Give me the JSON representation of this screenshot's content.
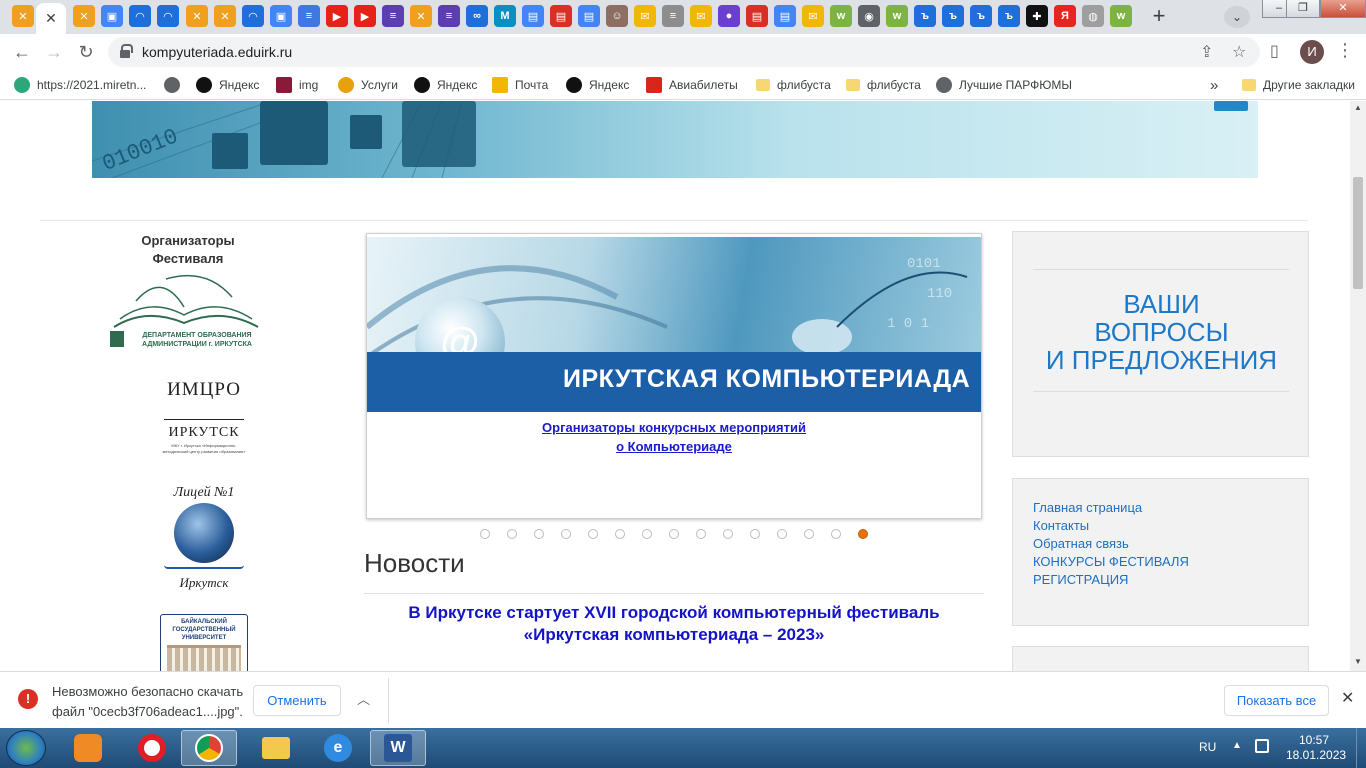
{
  "browser": {
    "url": "kompyuteriada.eduirk.ru",
    "new_tab_label": "+",
    "avatar_letter": "И",
    "bookmarks": [
      {
        "label": "https://2021.miretn...",
        "icon": "puzzle-icon",
        "color": "#2aa87a"
      },
      {
        "label": "",
        "icon": "globe-icon",
        "color": "#5f6368"
      },
      {
        "label": "Яндекс",
        "icon": "plus-circle-icon",
        "color": "#111111"
      },
      {
        "label": "img",
        "icon": "soundwave-icon",
        "color": "#8b1a3a"
      },
      {
        "label": "Услуги",
        "icon": "gosuslugi-icon",
        "color": "#e8a10a"
      },
      {
        "label": "Яндекс",
        "icon": "plus-circle-icon",
        "color": "#111111"
      },
      {
        "label": "Почта",
        "icon": "mail-icon",
        "color": "#f2b705"
      },
      {
        "label": "Яндекс",
        "icon": "plus-circle-icon",
        "color": "#111111"
      },
      {
        "label": "Авиабилеты",
        "icon": "ticket-icon",
        "color": "#d9261c"
      },
      {
        "label": "флибуста",
        "icon": "folder-icon",
        "color": "#f7d774"
      },
      {
        "label": "флибуста",
        "icon": "folder-icon",
        "color": "#f7d774"
      },
      {
        "label": "Лучшие ПАРФЮМЫ",
        "icon": "globe-icon",
        "color": "#5f6368"
      }
    ],
    "more_bookmarks": "»",
    "other_bookmarks": "Другие закладки"
  },
  "page": {
    "organizers_title": "Организаторы Фестиваля",
    "logos": {
      "dept": "ДЕПАРТАМЕНТ ОБРАЗОВАНИЯ АДМИНИСТРАЦИИ г. ИРКУТСКА",
      "imcro_top": "ИМЦРО",
      "imcro_city": "ИРКУТСК",
      "imcro_sub": "МКУ г. Иркутска «Информационно-методический центр развития образования»",
      "lyceum_top": "Лицей №1",
      "lyceum_bottom": "Иркутск",
      "bgu": "БАЙКАЛЬСКИЙ ГОСУДАРСТВЕННЫЙ УНИВЕРСИТЕТ"
    },
    "slider": {
      "title": "ИРКУТСКАЯ КОМПЬЮТЕРИАДА",
      "at_sign": "@",
      "link_line1": "Организаторы конкурсных мероприятий",
      "link_line2": "о Компьютериаде",
      "dot_count": 15,
      "active_dot": 15
    },
    "news_heading": "Новости",
    "news_title_line1": "В Иркутске стартует XVII городской компьютерный фестиваль",
    "news_title_line2": "«Иркутская компьютериада – 2023»",
    "questions": {
      "line1": "ВАШИ",
      "line2": "ВОПРОСЫ",
      "line3": "И ПРЕДЛОЖЕНИЯ"
    },
    "menu": [
      "Главная страница",
      "Контакты",
      "Обратная связь",
      "КОНКУРСЫ ФЕСТИВАЛЯ",
      "РЕГИСТРАЦИЯ"
    ]
  },
  "download": {
    "line1": "Невозможно безопасно скачать",
    "line2": "файл \"0cecb3f706adeac1....jpg\".",
    "cancel_label": "Отменить",
    "show_all_label": "Показать все"
  },
  "taskbar": {
    "lang": "RU",
    "time": "10:57",
    "date": "18.01.2023",
    "apps": [
      {
        "name": "media-player-icon",
        "color": "#f08a24"
      },
      {
        "name": "opera-icon",
        "color": "#e01e26"
      },
      {
        "name": "chrome-icon",
        "color": "#2c9a47"
      },
      {
        "name": "explorer-folder-icon",
        "color": "#f2c94c"
      },
      {
        "name": "internet-explorer-icon",
        "color": "#2f8be0"
      },
      {
        "name": "word-icon",
        "color": "#2b5797"
      }
    ]
  }
}
